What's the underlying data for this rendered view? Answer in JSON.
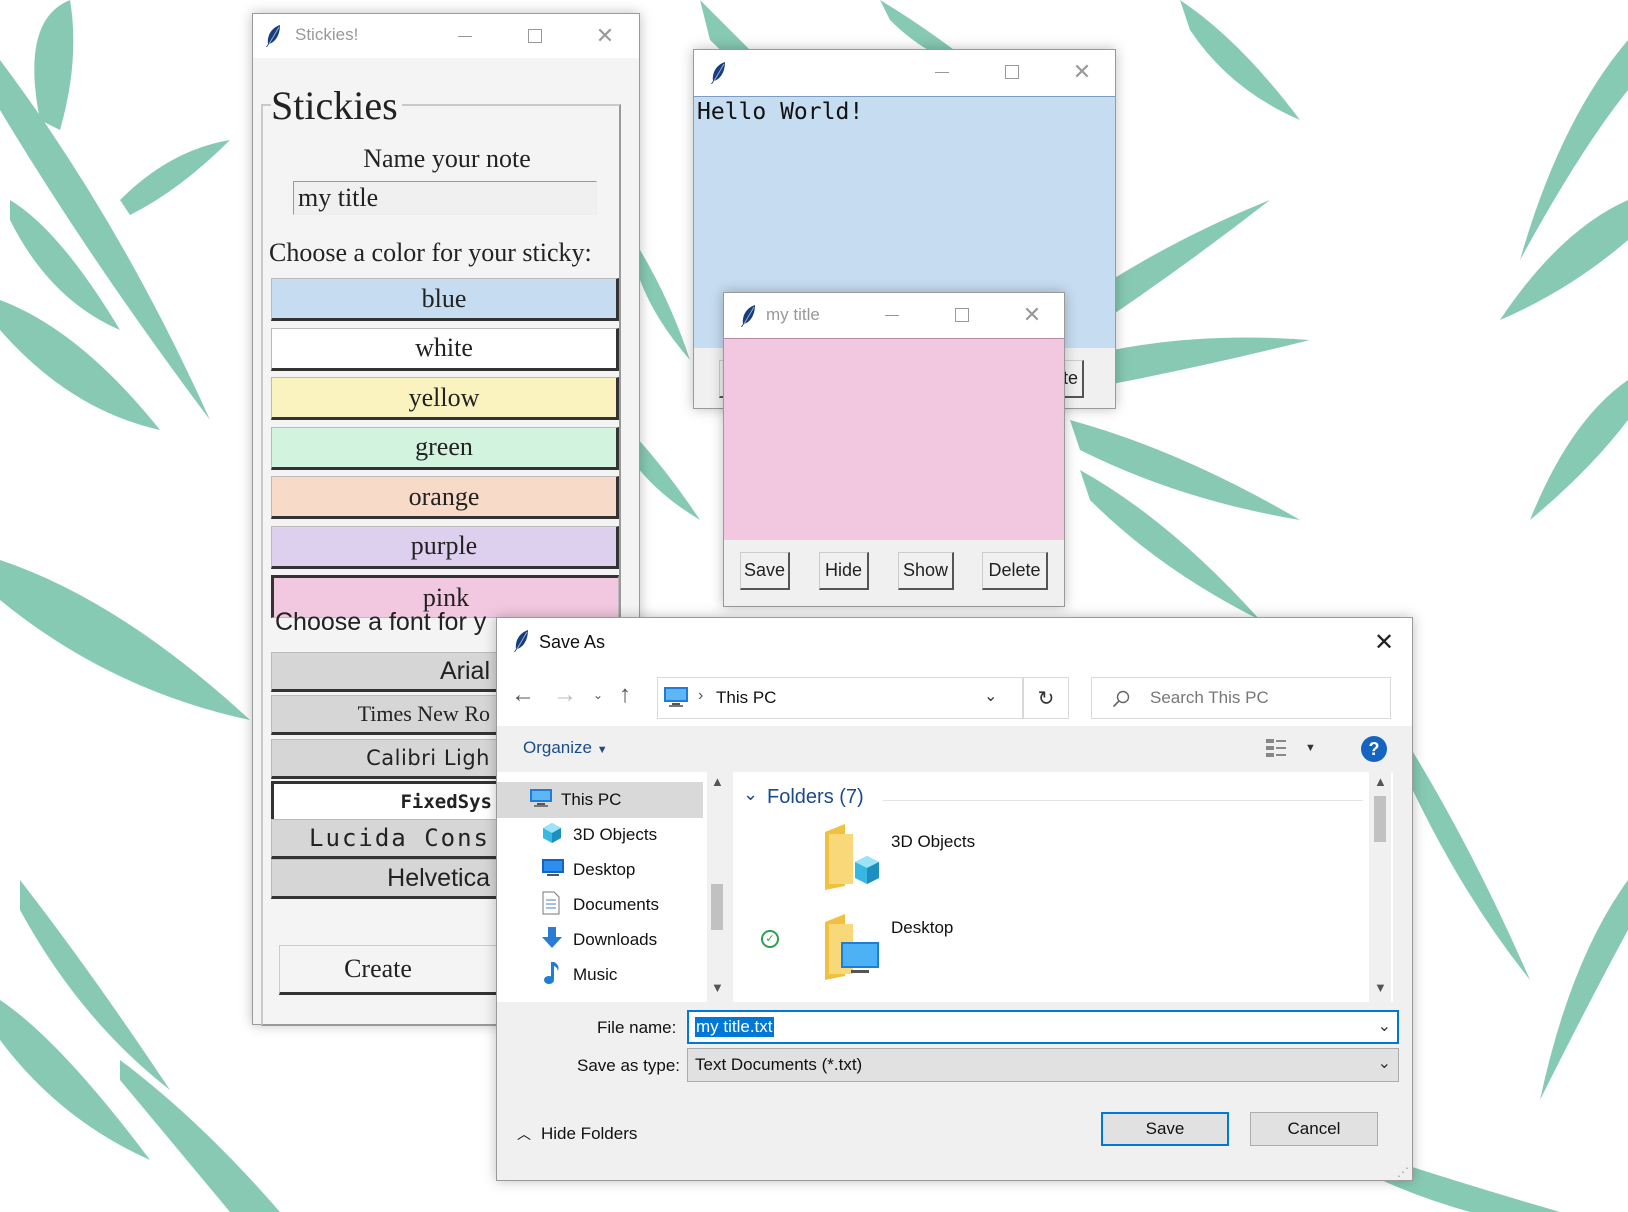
{
  "stickies_app": {
    "window_title": "Stickies!",
    "heading": "Stickies",
    "name_label": "Name your note",
    "name_value": "my title",
    "color_label": "Choose a color for your sticky:",
    "colors": [
      {
        "label": "blue",
        "hex": "#c6dcf0"
      },
      {
        "label": "white",
        "hex": "#ffffff"
      },
      {
        "label": "yellow",
        "hex": "#fbf3bf"
      },
      {
        "label": "green",
        "hex": "#d2f3de"
      },
      {
        "label": "orange",
        "hex": "#f7dac8"
      },
      {
        "label": "purple",
        "hex": "#ddd0ef"
      },
      {
        "label": "pink",
        "hex": "#f2c8e0"
      }
    ],
    "font_label": "Choose a font for y",
    "fonts": [
      "Arial",
      "Times New Ro",
      "Calibri Ligh",
      "FixedSys",
      "Lucida Cons",
      "Helvetica"
    ],
    "create_label": "Create"
  },
  "blue_note": {
    "window_title": "",
    "text": "Hello World!",
    "partial_button": "te",
    "color": "#c6dcf0"
  },
  "pink_note": {
    "window_title": "my title",
    "color": "#f2c8e0",
    "buttons": {
      "save": "Save",
      "hide": "Hide",
      "show": "Show",
      "delete": "Delete"
    }
  },
  "save_dialog": {
    "title": "Save As",
    "address": "This PC",
    "search_placeholder": "Search This PC",
    "organize": "Organize",
    "nav_items": [
      {
        "label": "This PC",
        "icon": "computer-icon"
      },
      {
        "label": "3D Objects",
        "icon": "cube-icon"
      },
      {
        "label": "Desktop",
        "icon": "desktop-icon"
      },
      {
        "label": "Documents",
        "icon": "document-icon"
      },
      {
        "label": "Downloads",
        "icon": "download-icon"
      },
      {
        "label": "Music",
        "icon": "music-icon"
      }
    ],
    "group_header": "Folders (7)",
    "folders": [
      {
        "label": "3D Objects"
      },
      {
        "label": "Desktop"
      }
    ],
    "file_name_label": "File name:",
    "file_name_value": "my title.txt",
    "save_type_label": "Save as type:",
    "save_type_value": "Text Documents (*.txt)",
    "hide_folders": "Hide Folders",
    "save_button": "Save",
    "cancel_button": "Cancel"
  }
}
